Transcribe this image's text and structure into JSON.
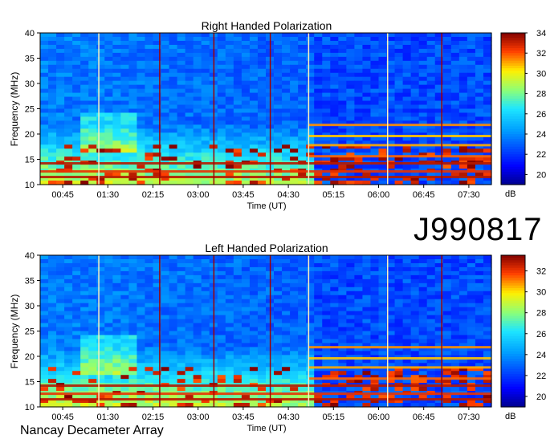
{
  "figure": {
    "identifier": "J990817",
    "footer": "Nancay Decameter Array",
    "colors": {
      "cold": "#00008f",
      "blue": "#1f5fff",
      "cyan": "#20d0ff",
      "yellow": "#f0f040",
      "red": "#a00000"
    }
  },
  "chart_data": [
    {
      "type": "heatmap",
      "title": "Right Handed Polarization",
      "xlabel": "Time (UT)",
      "ylabel": "Frequency (MHz)",
      "x_ticks": [
        "00:45",
        "01:30",
        "02:15",
        "03:00",
        "03:45",
        "04:30",
        "05:15",
        "06:00",
        "06:45",
        "07:30"
      ],
      "y_ticks": [
        10,
        15,
        20,
        25,
        30,
        35,
        40
      ],
      "ylim": [
        10,
        40
      ],
      "colorbar": {
        "label": "dB",
        "ticks": [
          20,
          22,
          24,
          26,
          28,
          30,
          32,
          34
        ],
        "range": [
          19,
          34
        ]
      }
    },
    {
      "type": "heatmap",
      "title": "Left Handed Polarization",
      "xlabel": "Time (UT)",
      "ylabel": "Frequency (MHz)",
      "x_ticks": [
        "00:45",
        "01:30",
        "02:15",
        "03:00",
        "03:45",
        "04:30",
        "05:15",
        "06:00",
        "06:45",
        "07:30"
      ],
      "y_ticks": [
        10,
        15,
        20,
        25,
        30,
        35,
        40
      ],
      "ylim": [
        10,
        40
      ],
      "colorbar": {
        "label": "dB",
        "ticks": [
          20,
          22,
          24,
          26,
          28,
          30,
          32
        ],
        "range": [
          19,
          33.5
        ]
      }
    }
  ]
}
